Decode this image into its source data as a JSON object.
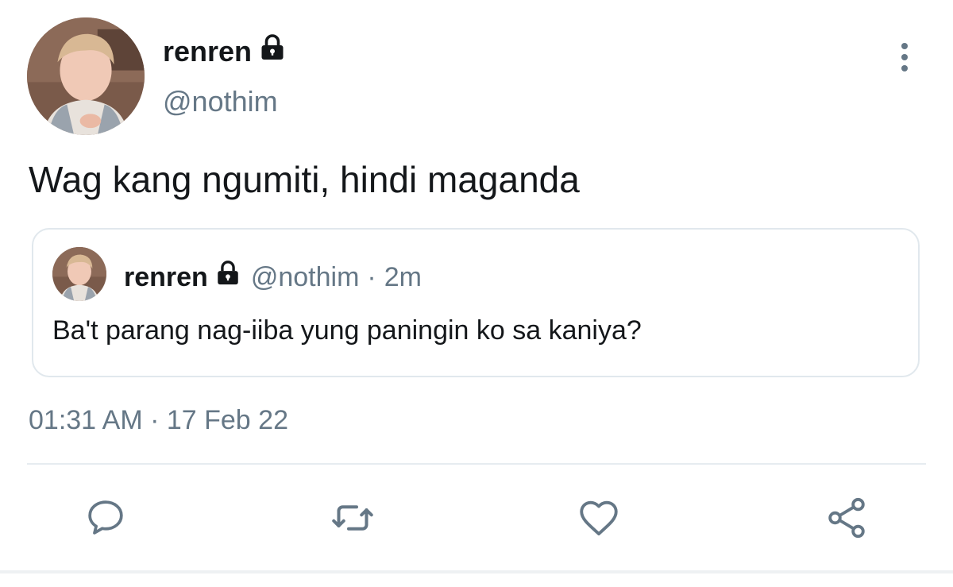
{
  "colors": {
    "text_primary": "#14171a",
    "text_secondary": "#657786",
    "border": "#e1e8ed",
    "icon": "#657786"
  },
  "author": {
    "display_name": "renren",
    "handle": "@nothim",
    "protected_icon": "lock-icon",
    "avatar": "avatar-photo"
  },
  "tweet": {
    "text": "Wag kang ngumiti, hindi maganda",
    "timestamp": "01:31 AM · 17 Feb 22"
  },
  "quoted_tweet": {
    "display_name": "renren",
    "handle": "@nothim",
    "separator": "·",
    "relative_time": "2m",
    "text": "Ba't parang nag-iiba yung paningin ko sa kaniya?",
    "protected_icon": "lock-icon",
    "avatar": "avatar-photo"
  },
  "actions": [
    {
      "name": "reply",
      "icon": "comment-icon"
    },
    {
      "name": "retweet",
      "icon": "retweet-icon"
    },
    {
      "name": "like",
      "icon": "heart-icon"
    },
    {
      "name": "share",
      "icon": "share-icon"
    }
  ],
  "menu_icon": "more-vertical-icon"
}
